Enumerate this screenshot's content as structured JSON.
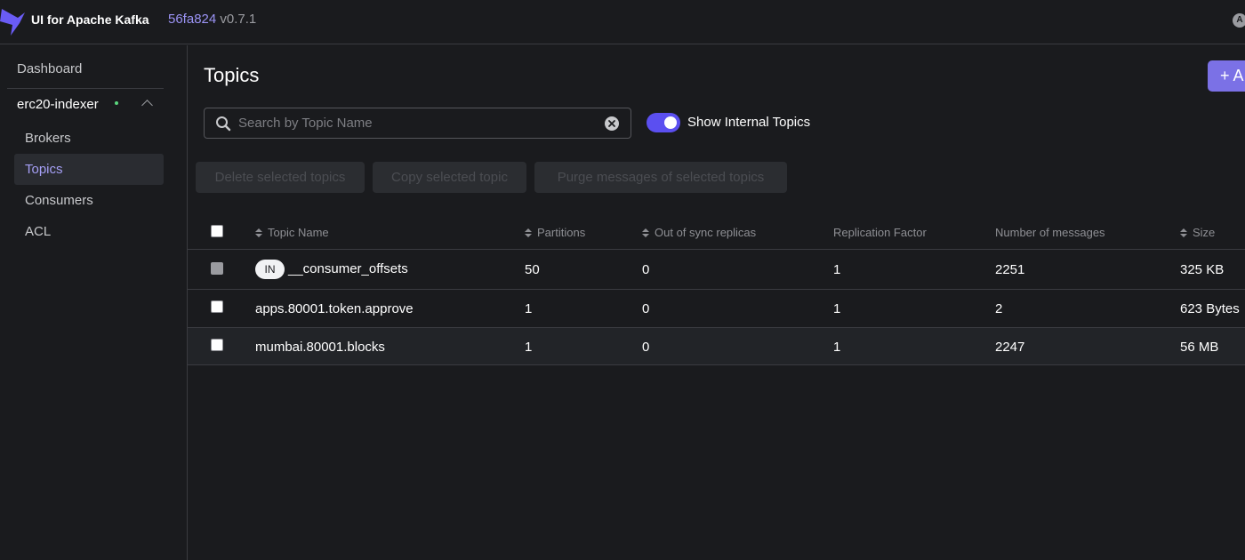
{
  "app": {
    "title": "UI for Apache Kafka",
    "commit": "56fa824",
    "version": "v0.7.1",
    "user_initial": "A"
  },
  "sidebar": {
    "dashboard": "Dashboard",
    "cluster": "erc20-indexer",
    "items": [
      {
        "label": "Brokers"
      },
      {
        "label": "Topics",
        "active": true
      },
      {
        "label": "Consumers"
      },
      {
        "label": "ACL"
      }
    ]
  },
  "main": {
    "title": "Topics",
    "add_button": "+ A",
    "search": {
      "placeholder": "Search by Topic Name",
      "value": ""
    },
    "toggle": {
      "label": "Show Internal Topics",
      "on": true
    },
    "actions": [
      "Delete selected topics",
      "Copy selected topic",
      "Purge messages of selected topics"
    ]
  },
  "table": {
    "columns": [
      "Topic Name",
      "Partitions",
      "Out of sync replicas",
      "Replication Factor",
      "Number of messages",
      "Size"
    ],
    "rows": [
      {
        "badge": "IN",
        "name": "__consumer_offsets",
        "partitions": "50",
        "out_of_sync": "0",
        "replication": "1",
        "messages": "2251",
        "size": "325 KB"
      },
      {
        "name": "apps.80001.token.approve",
        "partitions": "1",
        "out_of_sync": "0",
        "replication": "1",
        "messages": "2",
        "size": "623 Bytes"
      },
      {
        "name": "mumbai.80001.blocks",
        "partitions": "1",
        "out_of_sync": "0",
        "replication": "1",
        "messages": "2247",
        "size": "56 MB"
      }
    ]
  },
  "colors": {
    "accent": "#7b71e6",
    "toggle": "#5b4ff0",
    "active_nav": "#a59ff5",
    "cluster_status": "#5ad67d"
  }
}
